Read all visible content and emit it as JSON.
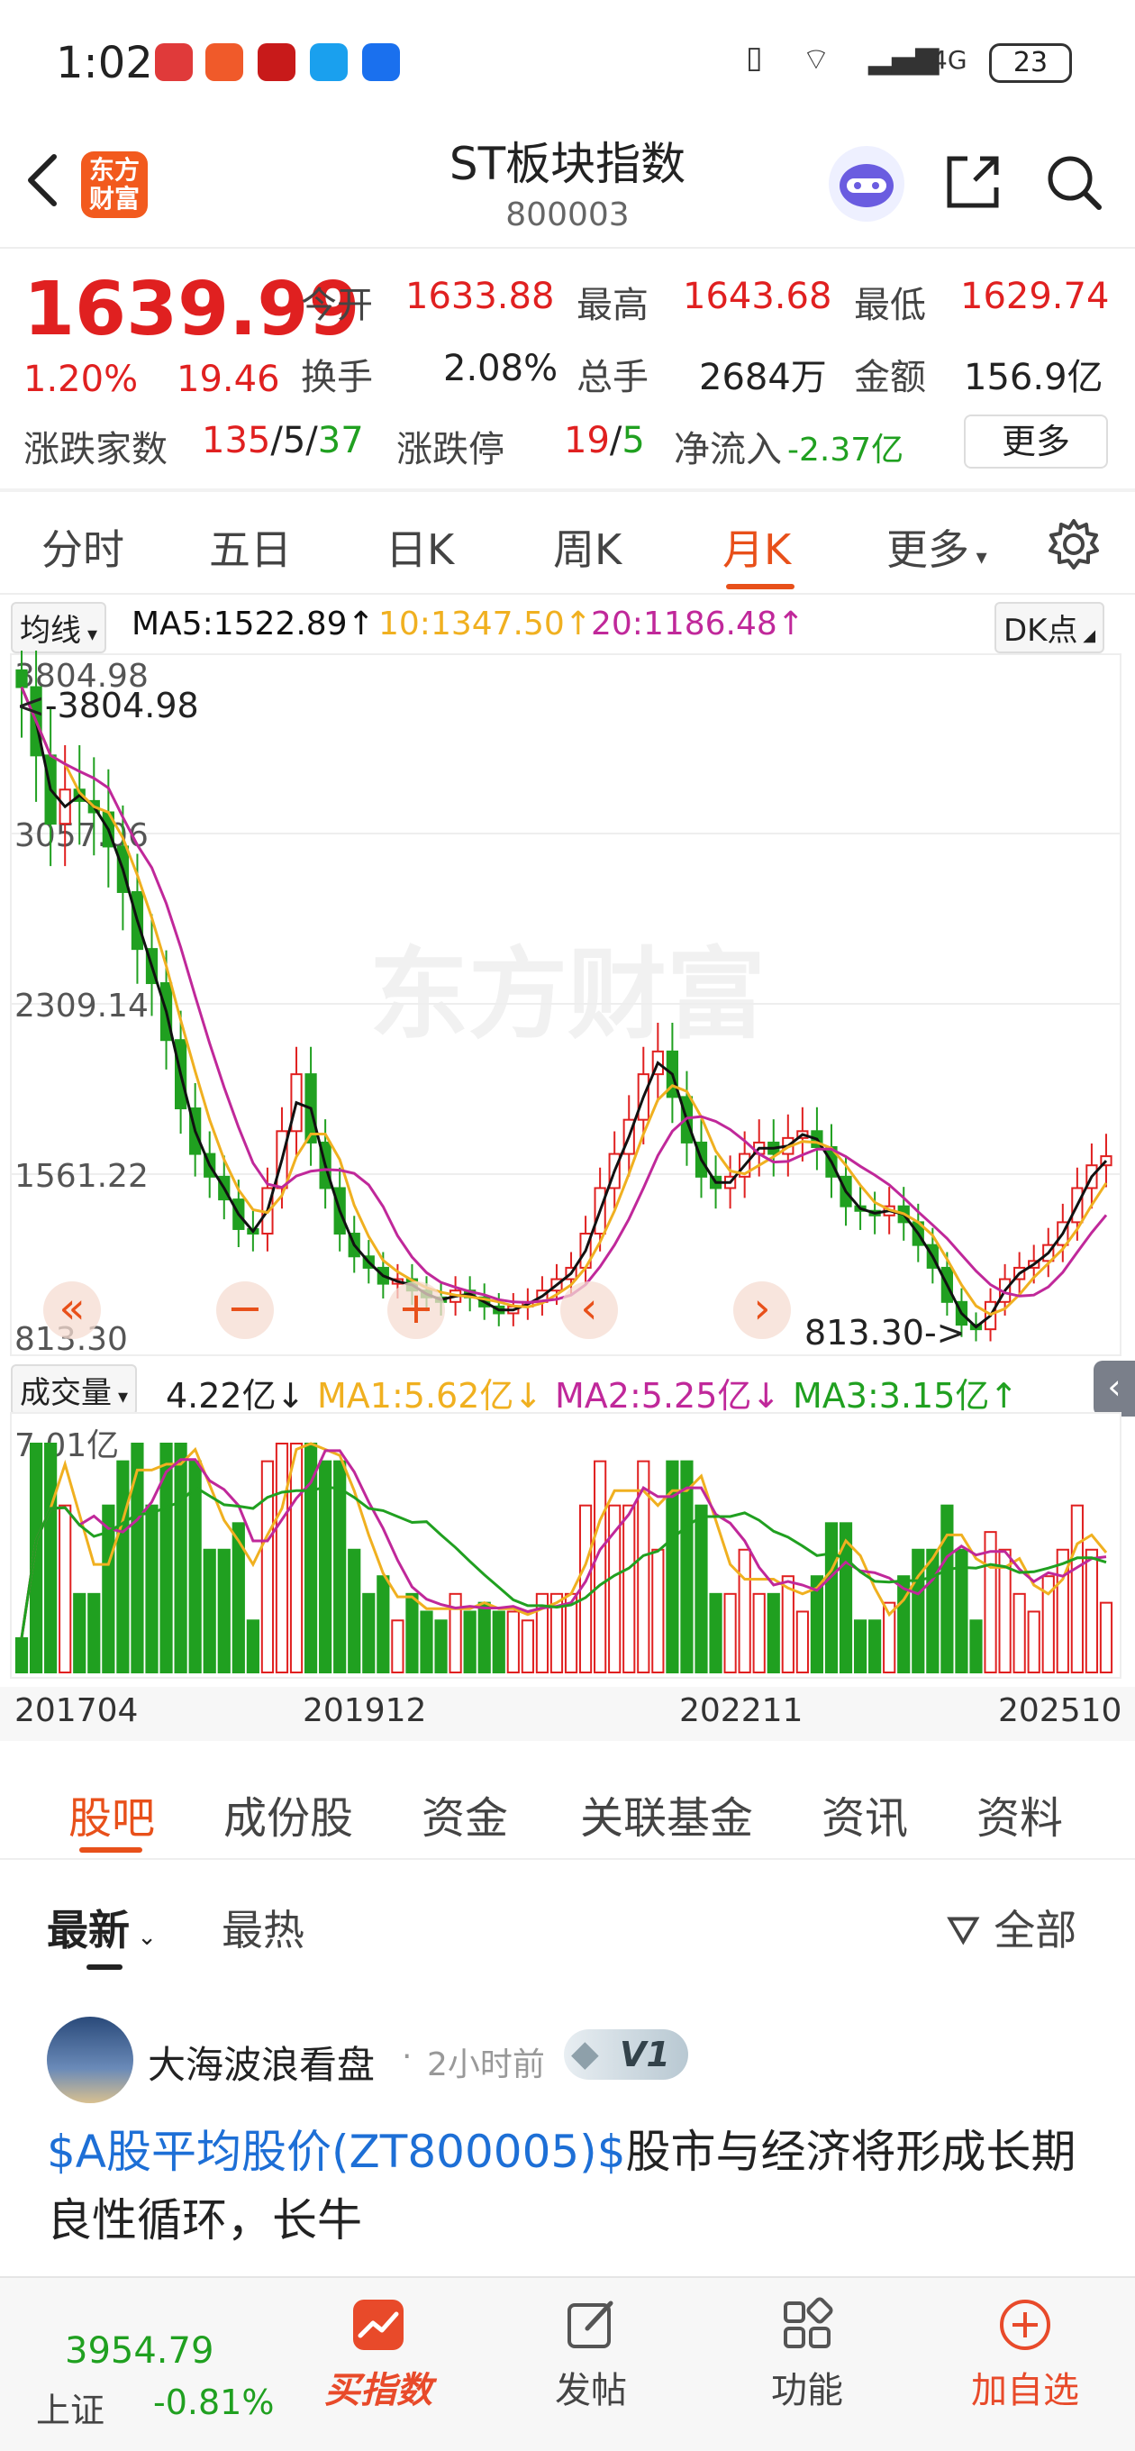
{
  "status_bar": {
    "time": "1:02",
    "signal_label": "4G",
    "battery": "23"
  },
  "header": {
    "title": "ST板块指数",
    "code": "800003",
    "logo_text_line1": "东方",
    "logo_text_line2": "财富",
    "back_icon": "chevron-left-icon",
    "share_icon": "share-icon",
    "search_icon": "search-icon"
  },
  "quote": {
    "price": "1639.99",
    "change_pct": "1.20%",
    "change": "19.46",
    "open_label": "今开",
    "open": "1633.88",
    "high_label": "最高",
    "high": "1643.68",
    "low_label": "最低",
    "low": "1629.74",
    "turnover_label": "换手",
    "turnover": "2.08%",
    "volume_label": "总手",
    "volume": "2684万",
    "amount_label": "金额",
    "amount": "156.9亿",
    "breadth_label": "涨跌家数",
    "up": "135",
    "flat": "5",
    "down": "37",
    "limit_label": "涨跌停",
    "limit_up": "19",
    "limit_down": "5",
    "netflow_label": "净流入",
    "netflow": "-2.37亿",
    "more_label": "更多"
  },
  "chart_tabs": [
    "分时",
    "五日",
    "日K",
    "周K",
    "月K",
    "更多"
  ],
  "active_chart_tab": "月K",
  "ma_bar": {
    "select": "均线",
    "ma5": "MA5:1522.89↑",
    "ma10": "10:1347.50↑",
    "ma20": "20:1186.48↑",
    "dk": "DK点"
  },
  "colors": {
    "up": "#e02020",
    "down": "#20a020",
    "ma5": "#111111",
    "ma10": "#f0b020",
    "ma20": "#c0289a",
    "accent": "#e8501a"
  },
  "chart_data": {
    "type": "candlestick",
    "price_axis_labels": [
      "3804.98",
      "3057.06",
      "2309.14",
      "1561.22",
      "813.30"
    ],
    "ylim": [
      813.3,
      3804.98
    ],
    "max_annotation": "<-3804.98",
    "min_annotation": "813.30->",
    "watermark": "东方财富",
    "x_tick_labels": [
      "201704",
      "201912",
      "202211",
      "202510"
    ],
    "close": [
      3700,
      3400,
      3100,
      3250,
      3200,
      3150,
      3000,
      2800,
      2550,
      2400,
      2150,
      1850,
      1650,
      1550,
      1450,
      1320,
      1300,
      1500,
      1750,
      2000,
      1700,
      1500,
      1300,
      1200,
      1150,
      1080,
      1100,
      1050,
      1020,
      1000,
      1050,
      1020,
      980,
      950,
      980,
      1000,
      1050,
      1100,
      1150,
      1300,
      1500,
      1650,
      1800,
      2000,
      2100,
      1900,
      1700,
      1550,
      1500,
      1550,
      1650,
      1700,
      1650,
      1720,
      1750,
      1680,
      1550,
      1420,
      1400,
      1380,
      1420,
      1350,
      1250,
      1150,
      1000,
      900,
      880,
      1000,
      1100,
      1150,
      1180,
      1250,
      1350,
      1500,
      1600,
      1640
    ],
    "volume_axis_label": "7.01亿",
    "volume_bar": {
      "select": "成交量",
      "value": "4.22亿↓",
      "ma1": "MA1:5.62亿↓",
      "ma2": "MA2:5.25亿↓",
      "ma3": "MA3:3.15亿↑"
    }
  },
  "bottom_tabs": [
    "股吧",
    "成份股",
    "资金",
    "关联基金",
    "资讯",
    "资料"
  ],
  "active_bottom_tab": "股吧",
  "filters": {
    "newest": "最新",
    "hottest": "最热",
    "all": "全部"
  },
  "post": {
    "author": "大海波浪看盘",
    "time": "2小时前",
    "badge": "V1",
    "link_text": "$A股平均股价(ZT800005)$",
    "text": "股市与经济将形成长期良性循环，长牛"
  },
  "bottom_nav": {
    "index_value": "3954.79",
    "index_name": "上证",
    "index_change": "-0.81%",
    "buy_index": "买指数",
    "post": "发帖",
    "features": "功能",
    "add_watch": "加自选"
  }
}
